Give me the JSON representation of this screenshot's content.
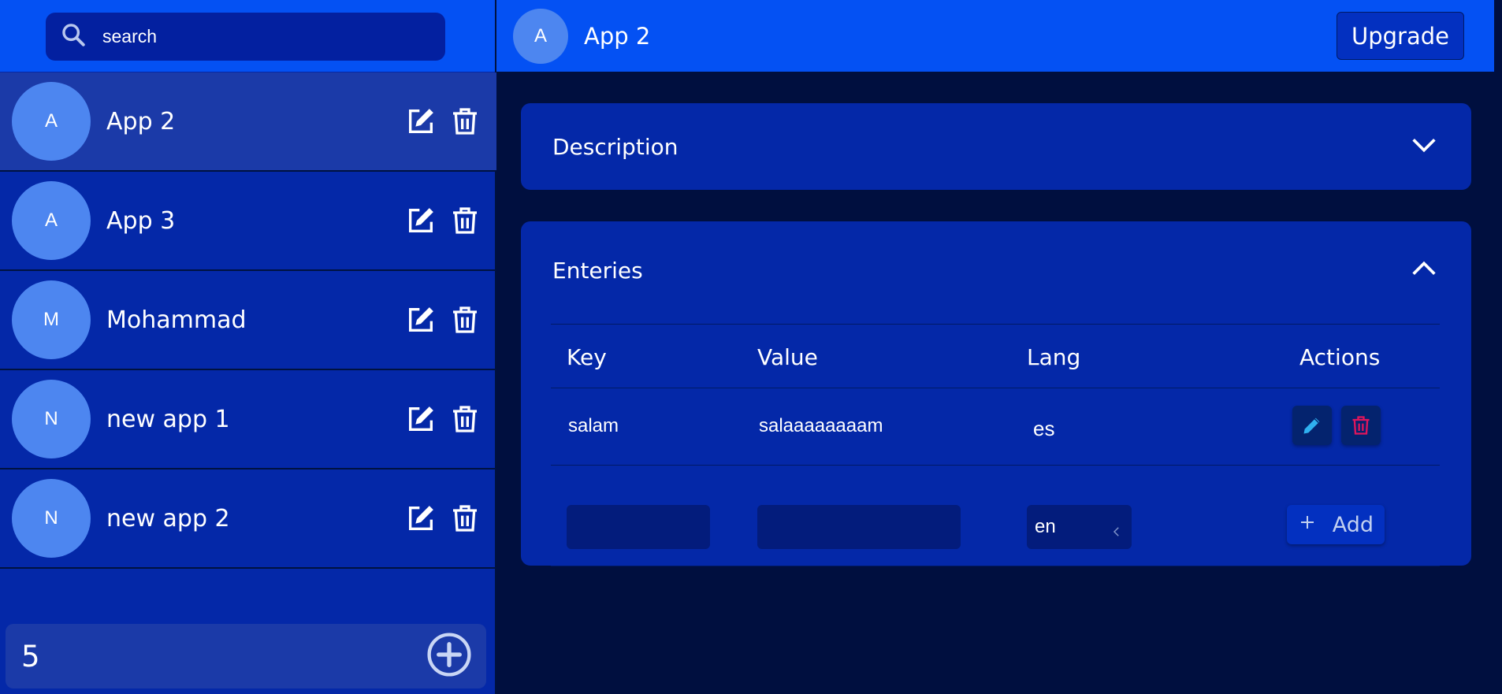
{
  "colors": {
    "accent": "#0451f3",
    "sidebar_bg": "#0428a8",
    "selected_bg": "#1b3aa8",
    "main_bg": "#000f3f",
    "avatar_bg": "#4d86f0",
    "edit_icon": "#2fb0f0",
    "delete_icon": "#e0155c"
  },
  "search": {
    "placeholder": "search",
    "icon": "search-icon"
  },
  "apps": [
    {
      "initial": "A",
      "name": "App 2",
      "selected": true
    },
    {
      "initial": "A",
      "name": "App 3",
      "selected": false
    },
    {
      "initial": "M",
      "name": "Mohammad",
      "selected": false
    },
    {
      "initial": "N",
      "name": "new app 1",
      "selected": false
    },
    {
      "initial": "N",
      "name": "new app 2",
      "selected": false
    }
  ],
  "sidebar_footer": {
    "value": "5",
    "add_icon": "plus-circle-icon"
  },
  "header": {
    "initial": "A",
    "title": "App 2",
    "upgrade_label": "Upgrade"
  },
  "description": {
    "title": "Description",
    "expanded": false
  },
  "entries": {
    "title": "Enteries",
    "expanded": true,
    "columns": [
      "Key",
      "Value",
      "Lang",
      "Actions"
    ],
    "rows": [
      {
        "key": "salam",
        "value": "salaaaaaaaam",
        "lang": "es"
      }
    ],
    "new_row": {
      "key": "",
      "value": "",
      "lang": "en",
      "add_label": "Add"
    }
  }
}
